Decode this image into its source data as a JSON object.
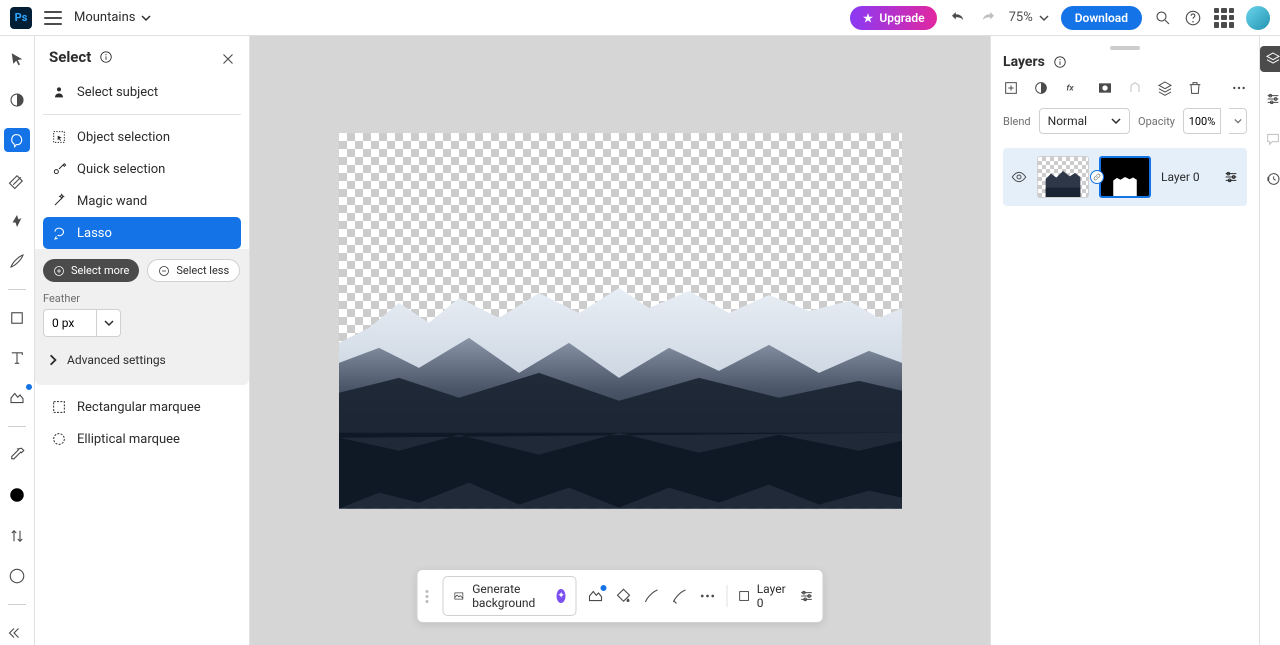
{
  "header": {
    "doc_name": "Mountains",
    "upgrade": "Upgrade",
    "zoom": "75%",
    "download": "Download"
  },
  "select_panel": {
    "title": "Select",
    "items": {
      "subject": "Select subject",
      "object": "Object selection",
      "quick": "Quick selection",
      "wand": "Magic wand",
      "lasso": "Lasso",
      "rect": "Rectangular marquee",
      "ellipse": "Elliptical marquee"
    },
    "select_more": "Select more",
    "select_less": "Select less",
    "feather_label": "Feather",
    "feather_value": "0 px",
    "advanced": "Advanced settings"
  },
  "context_bar": {
    "generate": "Generate background",
    "layer": "Layer 0"
  },
  "layers": {
    "title": "Layers",
    "blend_label": "Blend",
    "blend_value": "Normal",
    "opacity_label": "Opacity",
    "opacity_value": "100%",
    "layer0": "Layer 0"
  }
}
